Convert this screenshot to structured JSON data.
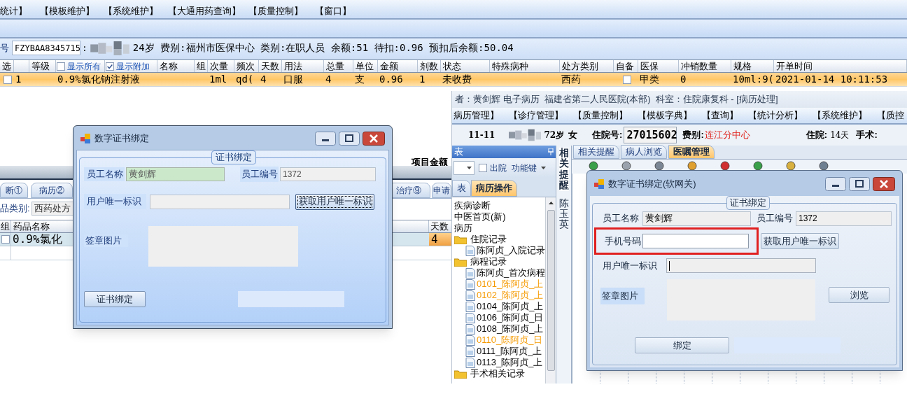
{
  "main_app": {
    "menu": [
      "统计】",
      "【模板维护】",
      "【系统维护】",
      "【大通用药查询】",
      "【质量控制】",
      "【窗口】"
    ],
    "patient": {
      "card_label": "号",
      "card_no": "FZYBAA8345715",
      "separator": ":",
      "info": "24岁 费别:福州市医保中心 类别:在职人员 余额:51 待扣:0.96 预扣后余额:50.04"
    },
    "orders_table": {
      "columns": [
        {
          "kind": "text",
          "label": "选"
        },
        {
          "kind": "blank"
        },
        {
          "kind": "text",
          "label": "等级"
        },
        {
          "kind": "checkbox",
          "label": "显示所有",
          "checked": false
        },
        {
          "kind": "checkbox",
          "label": "显示附加",
          "checked": true
        },
        {
          "kind": "text",
          "label": "名称"
        },
        {
          "kind": "text",
          "label": "组"
        },
        {
          "kind": "text",
          "label": "次量"
        },
        {
          "kind": "text",
          "label": "频次"
        },
        {
          "kind": "text",
          "label": "天数"
        },
        {
          "kind": "text",
          "label": "用法"
        },
        {
          "kind": "text",
          "label": "总量"
        },
        {
          "kind": "text",
          "label": "单位"
        },
        {
          "kind": "text",
          "label": "金额"
        },
        {
          "kind": "text",
          "label": "剂数"
        },
        {
          "kind": "text",
          "label": "状态"
        },
        {
          "kind": "text",
          "label": "特殊病种"
        },
        {
          "kind": "text",
          "label": "处方类别"
        },
        {
          "kind": "text",
          "label": "自备"
        },
        {
          "kind": "text",
          "label": "医保"
        },
        {
          "kind": "text",
          "label": "冲销数量"
        },
        {
          "kind": "text",
          "label": "规格"
        },
        {
          "kind": "text",
          "label": "开单时间"
        }
      ],
      "rows": [
        {
          "selected": true,
          "cells": [
            {
              "kind": "checkbox",
              "checked": false
            },
            {
              "kind": "text",
              "text": "1"
            },
            {
              "kind": "blank"
            },
            {
              "kind": "text",
              "text": "0.9%氯化钠注射液"
            },
            {
              "kind": "blank"
            },
            {
              "kind": "blank"
            },
            {
              "kind": "blank"
            },
            {
              "kind": "text",
              "text": "1ml"
            },
            {
              "kind": "text",
              "text": "qd("
            },
            {
              "kind": "text",
              "text": "4"
            },
            {
              "kind": "text",
              "text": "口服"
            },
            {
              "kind": "text",
              "text": "4"
            },
            {
              "kind": "text",
              "text": "支"
            },
            {
              "kind": "text",
              "text": "0.96"
            },
            {
              "kind": "text",
              "text": "1"
            },
            {
              "kind": "text",
              "text": "未收费"
            },
            {
              "kind": "blank"
            },
            {
              "kind": "text",
              "text": "西药"
            },
            {
              "kind": "checkbox",
              "checked": false
            },
            {
              "kind": "text",
              "text": "甲类"
            },
            {
              "kind": "text",
              "text": "0"
            },
            {
              "kind": "text",
              "text": "10ml:9("
            },
            {
              "kind": "text",
              "text": "2021-01-14 10:11:53"
            }
          ]
        }
      ]
    },
    "amount_label": "项目金额",
    "tabs": [
      {
        "label": "断①",
        "selected": false
      },
      {
        "label": "病历②",
        "selected": false
      },
      {
        "label": "治疗⑨",
        "selected": false
      },
      {
        "label": "申请",
        "selected": false
      }
    ],
    "drug_category": {
      "label": "品类别:",
      "value": "西药处方"
    },
    "drug_table": {
      "columns": [
        "组",
        "药品名称",
        "天数"
      ],
      "rows": [
        {
          "checked": false,
          "name": "0.9%氯化",
          "days": "4"
        }
      ]
    }
  },
  "cert_dialog": {
    "title": "数字证书绑定",
    "group": "证书绑定",
    "staff_name": {
      "label": "员工名称",
      "value": "黄剑辉"
    },
    "staff_no": {
      "label": "员工编号",
      "value": "1372"
    },
    "user_id": {
      "label": "用户唯一标识"
    },
    "get_id_button": "获取用户唯一标识",
    "seal": {
      "label": "签章图片"
    },
    "bind_button": "证书绑定"
  },
  "emr_window": {
    "title": "者：黄剑辉 电子病历  福建省第二人民医院(本部)  科室：住院康复科 - [病历处理]",
    "menu": [
      "病历管理】",
      "【诊疗管理】",
      "【质量控制】",
      "【模板字典】",
      "【查询】",
      "【统计分析】",
      "【系统维护】",
      "【质控"
    ],
    "info": {
      "bed": "11-11",
      "age": "72岁",
      "sex": "女",
      "admission_label": "住院号:",
      "admission_no": "27015602",
      "fee_label": "费别:",
      "fee_value": "连江分中心",
      "stay_label": "住院:",
      "stay_value": "14天",
      "surgery_label": "手术:"
    },
    "side_panel": {
      "header": "表",
      "discharged": {
        "label": "出院",
        "checked": false
      },
      "function_key": "功能键",
      "tabs": [
        {
          "label": "表",
          "selected": false
        },
        {
          "label": "病历操作",
          "selected": true
        }
      ],
      "tree": [
        {
          "kind": "item",
          "label": "疾病诊断"
        },
        {
          "kind": "item",
          "label": "中医首页(新)"
        },
        {
          "kind": "item",
          "label": "病历"
        },
        {
          "kind": "folder",
          "label": "住院记录",
          "children": [
            {
              "kind": "doc",
              "label": "陈阿贞_入院记录"
            }
          ]
        },
        {
          "kind": "folder",
          "label": "病程记录",
          "children": [
            {
              "kind": "doc",
              "label": "陈阿贞_首次病程"
            },
            {
              "kind": "doc",
              "label": "0101_陈阿贞_上",
              "color": "#f59a00"
            },
            {
              "kind": "doc",
              "label": "0102_陈阿贞_上",
              "color": "#f59a00"
            },
            {
              "kind": "doc",
              "label": "0104_陈阿贞_上",
              "color": "#000000"
            },
            {
              "kind": "doc",
              "label": "0106_陈阿贞_日",
              "color": "#000000"
            },
            {
              "kind": "doc",
              "label": "0108_陈阿贞_上",
              "color": "#000000"
            },
            {
              "kind": "doc",
              "label": "0110_陈阿贞_日",
              "color": "#f59a00"
            },
            {
              "kind": "doc",
              "label": "0111_陈阿贞_上",
              "color": "#000000"
            },
            {
              "kind": "doc",
              "label": "0113_陈阿贞_上",
              "color": "#000000"
            }
          ]
        },
        {
          "kind": "folder",
          "label": "手术相关记录"
        }
      ]
    },
    "vertical_tab": "相关提醒",
    "tabs": [
      {
        "label": "相关提醒",
        "selected": false
      },
      {
        "label": "病人浏览",
        "selected": false
      },
      {
        "label": "医嘱管理",
        "selected": true
      }
    ],
    "patient_name_vertical": "陈玉英"
  },
  "gateway_dialog": {
    "title": "数字证书绑定(软网关)",
    "group": "证书绑定",
    "staff_name": {
      "label": "员工名称",
      "value": "黄剑辉"
    },
    "staff_no": {
      "label": "员工编号",
      "value": "1372"
    },
    "phone": {
      "label": "手机号码",
      "highlighted": true
    },
    "get_id_button": "获取用户唯一标识",
    "user_id": {
      "label": "用户唯一标识",
      "focused": true
    },
    "seal": {
      "label": "签章图片"
    },
    "browse_button": "浏览",
    "bind_button": "绑定"
  }
}
